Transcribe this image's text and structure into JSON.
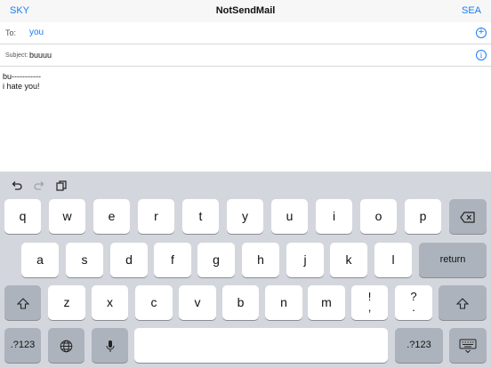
{
  "navbar": {
    "left_label": "SKY",
    "title": "NotSendMail",
    "right_label": "SEA"
  },
  "compose": {
    "to_label": "To:",
    "to_value": "you",
    "subject_label": "Subject:",
    "subject_value": "buuuu",
    "body_lines": [
      "bu-----------",
      "i hate you!"
    ]
  },
  "keyboard": {
    "toolbar_icons": [
      "undo-icon",
      "redo-icon",
      "paste-icon"
    ],
    "row1": [
      "q",
      "w",
      "e",
      "r",
      "t",
      "y",
      "u",
      "i",
      "o",
      "p"
    ],
    "row2": [
      "a",
      "s",
      "d",
      "f",
      "g",
      "h",
      "j",
      "k",
      "l"
    ],
    "row3": [
      "z",
      "x",
      "c",
      "v",
      "b",
      "n",
      "m"
    ],
    "return_label": "return",
    "punct1_top": "!",
    "punct1_bottom": ",",
    "punct2_top": "?",
    "punct2_bottom": ".",
    "numbers_label": ".?123",
    "numbers_label_right": ".?123"
  }
}
